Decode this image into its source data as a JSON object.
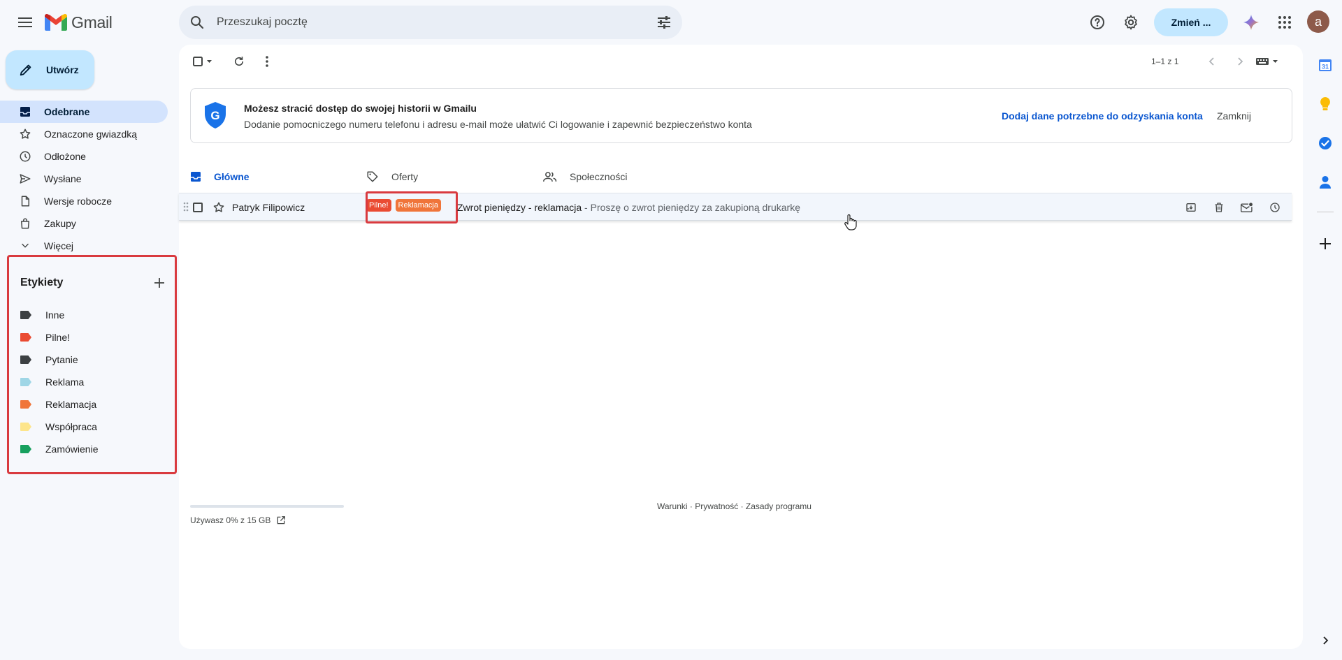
{
  "header": {
    "logo_text": "Gmail",
    "search_placeholder": "Przeszukaj pocztę",
    "switch_label": "Zmień ...",
    "avatar_letter": "a"
  },
  "sidebar": {
    "compose_label": "Utwórz",
    "items": [
      {
        "label": "Odebrane",
        "icon": "inbox-icon",
        "active": true
      },
      {
        "label": "Oznaczone gwiazdką",
        "icon": "star-icon"
      },
      {
        "label": "Odłożone",
        "icon": "clock-icon"
      },
      {
        "label": "Wysłane",
        "icon": "send-icon"
      },
      {
        "label": "Wersje robocze",
        "icon": "draft-icon"
      },
      {
        "label": "Zakupy",
        "icon": "shopping-bag-icon"
      },
      {
        "label": "Więcej",
        "icon": "chevron-down-icon"
      }
    ],
    "labels_title": "Etykiety",
    "labels": [
      {
        "name": "Inne",
        "color": "#3c4043"
      },
      {
        "name": "Pilne!",
        "color": "#ea4b32"
      },
      {
        "name": "Pytanie",
        "color": "#3c4043"
      },
      {
        "name": "Reklama",
        "color": "#9fd6e6"
      },
      {
        "name": "Reklamacja",
        "color": "#f0753a"
      },
      {
        "name": "Współpraca",
        "color": "#fde58b"
      },
      {
        "name": "Zamówienie",
        "color": "#17a05e"
      }
    ]
  },
  "toolbar": {
    "pager": "1–1 z 1"
  },
  "banner": {
    "title": "Możesz stracić dostęp do swojej historii w Gmailu",
    "subtitle": "Dodanie pomocniczego numeru telefonu i adresu e-mail może ułatwić Ci logowanie i zapewnić bezpieczeństwo konta",
    "action": "Dodaj dane potrzebne do odzyskania konta",
    "close": "Zamknij"
  },
  "tabs": [
    {
      "label": "Główne",
      "icon": "inbox-icon",
      "active": true
    },
    {
      "label": "Oferty",
      "icon": "tag-icon"
    },
    {
      "label": "Społeczności",
      "icon": "people-icon"
    }
  ],
  "emails": [
    {
      "sender": "Patryk Filipowicz",
      "labels": [
        {
          "name": "Pilne!",
          "color": "#ea4b32"
        },
        {
          "name": "Reklamacja",
          "color": "#f0753a"
        }
      ],
      "subject": "Zwrot pieniędzy - reklamacja",
      "snippet": " - Proszę o zwrot pieniędzy za zakupioną drukarkę"
    }
  ],
  "footer": {
    "storage": "Używasz 0% z 15 GB",
    "links": "Warunki · Prywatność · Zasady programu"
  },
  "colors": {
    "accent": "#0b57d0",
    "compose": "#c2e7ff",
    "active_nav": "#d3e3fd",
    "highlight": "#d93a3f"
  }
}
